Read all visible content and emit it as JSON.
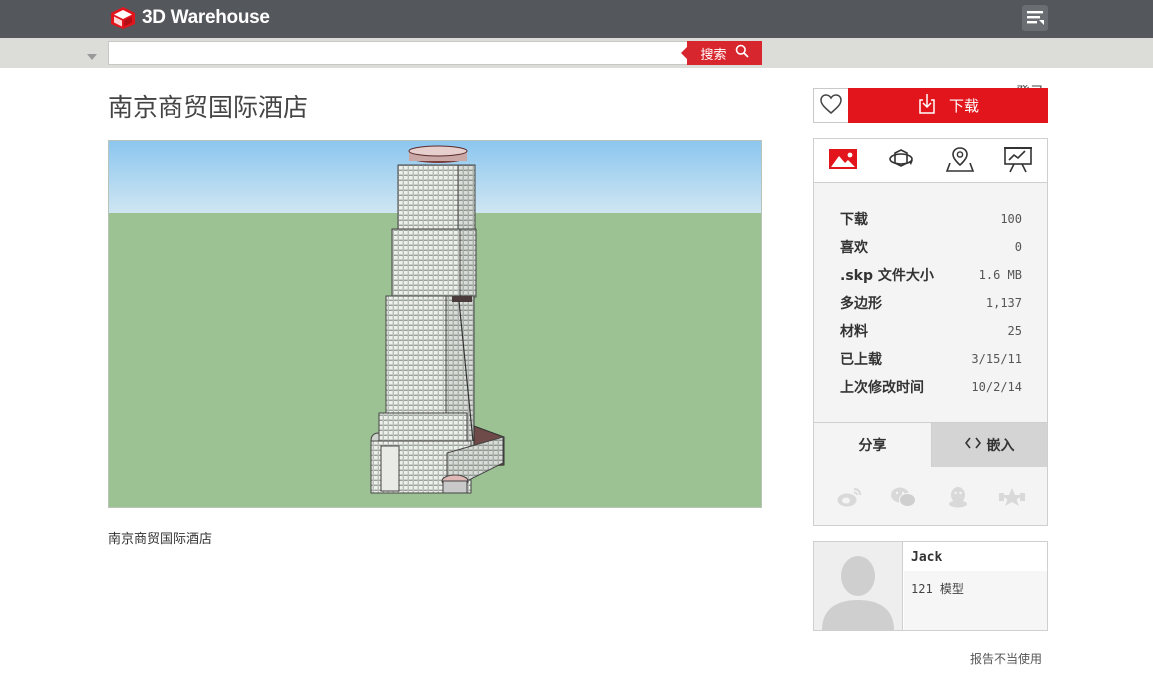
{
  "header": {
    "site_name": "3D Warehouse",
    "menu_icon": "hamburger-menu-icon"
  },
  "search": {
    "value": "",
    "placeholder": "",
    "button_label": "搜索",
    "login_label": "登录"
  },
  "model": {
    "title": "南京商贸国际酒店",
    "description": "南京商贸国际酒店"
  },
  "actions": {
    "download_label": "下载"
  },
  "info_tabs": [
    "picture-icon",
    "3d-rotate-icon",
    "location-pin-icon",
    "chart-icon"
  ],
  "stats": [
    {
      "label": "下载",
      "value": "100"
    },
    {
      "label": "喜欢",
      "value": "0"
    },
    {
      "label": ".skp 文件大小",
      "value": "1.6 MB"
    },
    {
      "label": "多边形",
      "value": "1,137"
    },
    {
      "label": "材料",
      "value": "25"
    },
    {
      "label": "已上载",
      "value": "3/15/11"
    },
    {
      "label": "上次修改时间",
      "value": "10/2/14"
    }
  ],
  "share": {
    "share_label": "分享",
    "embed_label": "嵌入",
    "social": [
      "weibo-icon",
      "wechat-icon",
      "qq-icon",
      "qzone-icon"
    ]
  },
  "author": {
    "name": "Jack",
    "models": "121 模型"
  },
  "footer": {
    "report_label": "报告不当使用"
  },
  "colors": {
    "header": "#54575c",
    "accent": "#e2151c",
    "sky": "#a6d2ee",
    "ground": "#9cc294"
  }
}
